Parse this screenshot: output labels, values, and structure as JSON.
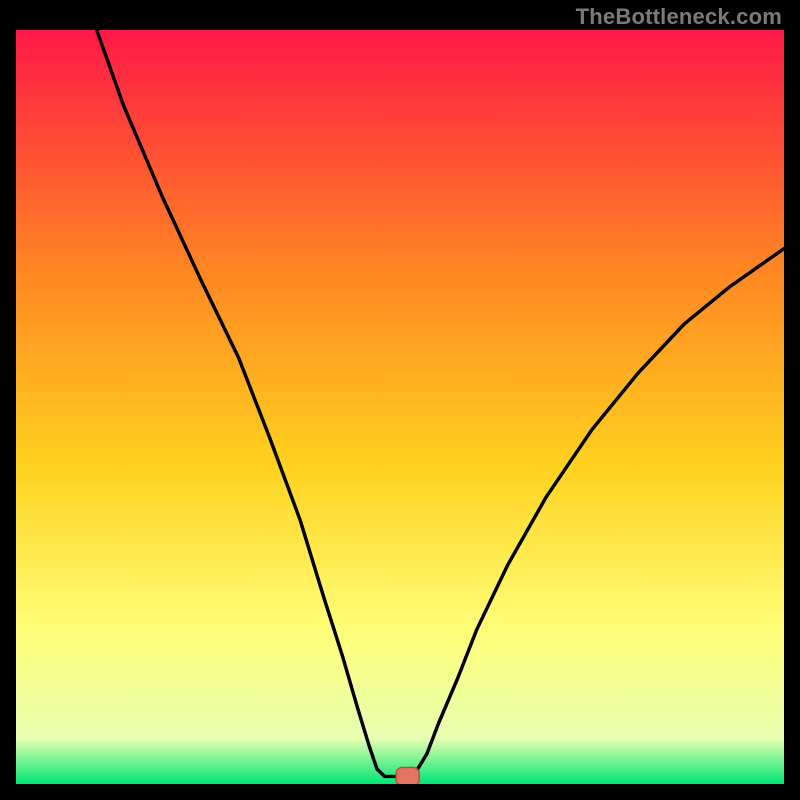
{
  "watermark": "TheBottleneck.com",
  "chart_data": {
    "type": "line",
    "title": "",
    "xlabel": "",
    "ylabel": "",
    "xlim": [
      0,
      100
    ],
    "ylim": [
      0,
      100
    ],
    "grid": false,
    "legend": false,
    "gradient_colors": {
      "top": "#ff1846",
      "upper_mid": "#ff8a22",
      "mid": "#ffd21f",
      "lower_mid": "#ffff7a",
      "near_bottom": "#e6ffb0",
      "bottom_edge": "#00e676"
    },
    "series": [
      {
        "name": "curve",
        "stroke": "#000000",
        "stroke_width": 3,
        "points": [
          {
            "x": 10.5,
            "y": 100.0
          },
          {
            "x": 14.0,
            "y": 90.0
          },
          {
            "x": 19.0,
            "y": 78.0
          },
          {
            "x": 24.0,
            "y": 67.0
          },
          {
            "x": 29.0,
            "y": 56.5
          },
          {
            "x": 33.0,
            "y": 46.0
          },
          {
            "x": 37.0,
            "y": 35.0
          },
          {
            "x": 40.0,
            "y": 25.0
          },
          {
            "x": 42.5,
            "y": 17.0
          },
          {
            "x": 44.5,
            "y": 10.0
          },
          {
            "x": 46.0,
            "y": 5.0
          },
          {
            "x": 47.0,
            "y": 2.0
          },
          {
            "x": 48.0,
            "y": 1.0
          },
          {
            "x": 49.0,
            "y": 1.0
          },
          {
            "x": 50.0,
            "y": 1.0
          },
          {
            "x": 51.0,
            "y": 1.0
          },
          {
            "x": 52.0,
            "y": 1.5
          },
          {
            "x": 53.5,
            "y": 4.0
          },
          {
            "x": 55.0,
            "y": 8.0
          },
          {
            "x": 57.5,
            "y": 14.0
          },
          {
            "x": 60.0,
            "y": 20.5
          },
          {
            "x": 64.0,
            "y": 29.0
          },
          {
            "x": 69.0,
            "y": 38.0
          },
          {
            "x": 75.0,
            "y": 47.0
          },
          {
            "x": 81.0,
            "y": 54.5
          },
          {
            "x": 87.0,
            "y": 61.0
          },
          {
            "x": 93.0,
            "y": 66.0
          },
          {
            "x": 100.0,
            "y": 71.0
          }
        ]
      }
    ],
    "marker": {
      "name": "current-point",
      "x": 51.0,
      "y": 1.0,
      "rx": 1.5,
      "ry": 1.2,
      "fill": "#e57362",
      "stroke": "#b84c3c"
    }
  }
}
